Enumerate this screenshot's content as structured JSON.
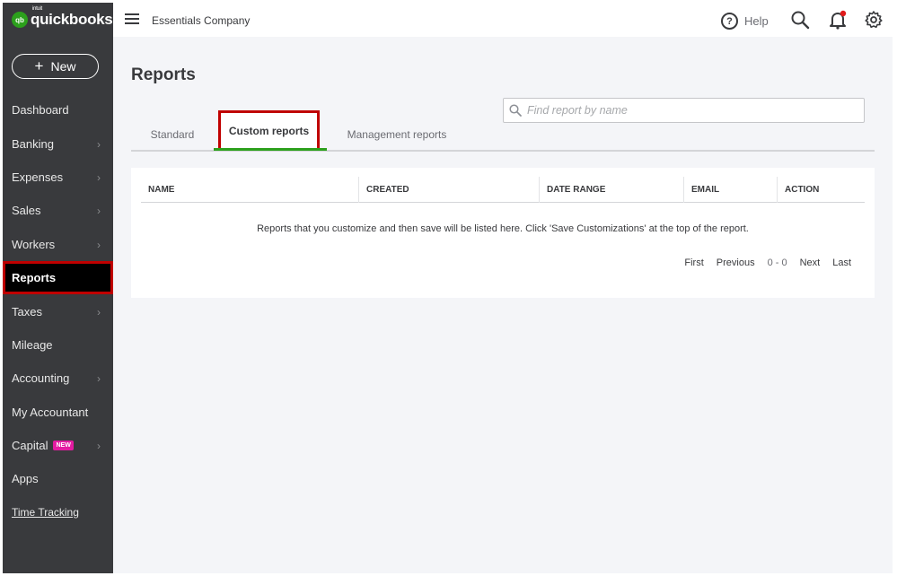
{
  "brand": {
    "logo_mark": "qb",
    "intuit": "intuit",
    "name": "quickbooks"
  },
  "new_button": {
    "plus": "+",
    "label": "New"
  },
  "sidebar": {
    "items": [
      {
        "label": "Dashboard",
        "chevron": ""
      },
      {
        "label": "Banking",
        "chevron": "›"
      },
      {
        "label": "Expenses",
        "chevron": "›"
      },
      {
        "label": "Sales",
        "chevron": "›"
      },
      {
        "label": "Workers",
        "chevron": "›"
      },
      {
        "label": "Reports",
        "chevron": ""
      },
      {
        "label": "Taxes",
        "chevron": "›"
      },
      {
        "label": "Mileage",
        "chevron": ""
      },
      {
        "label": "Accounting",
        "chevron": "›"
      },
      {
        "label": "My Accountant",
        "chevron": ""
      },
      {
        "label": "Capital",
        "chevron": "›",
        "badge": "NEW"
      },
      {
        "label": "Apps",
        "chevron": ""
      },
      {
        "label": "Time Tracking",
        "chevron": ""
      }
    ],
    "active": "Reports"
  },
  "topbar": {
    "company": "Essentials Company",
    "help_symbol": "?",
    "help_label": "Help"
  },
  "page": {
    "title": "Reports"
  },
  "search": {
    "placeholder": "Find report by name"
  },
  "tabs": [
    {
      "label": "Standard"
    },
    {
      "label": "Custom reports"
    },
    {
      "label": "Management reports"
    }
  ],
  "table": {
    "columns": [
      "NAME",
      "CREATED",
      "DATE RANGE",
      "EMAIL",
      "ACTION"
    ],
    "empty_message": "Reports that you customize and then save will be listed here. Click 'Save Customizations' at the top of the report."
  },
  "pager": {
    "first": "First",
    "previous": "Previous",
    "range": "0 - 0",
    "next": "Next",
    "last": "Last"
  },
  "colors": {
    "sidebar": "#393a3d",
    "accent_green": "#2ca01c",
    "highlight_red": "#c00000",
    "badge": "#e31ba1",
    "page_bg": "#f4f5f8"
  },
  "icons": [
    "hamburger-icon",
    "help-icon",
    "search-icon",
    "bell-icon",
    "gear-icon",
    "chevron-right-icon"
  ]
}
